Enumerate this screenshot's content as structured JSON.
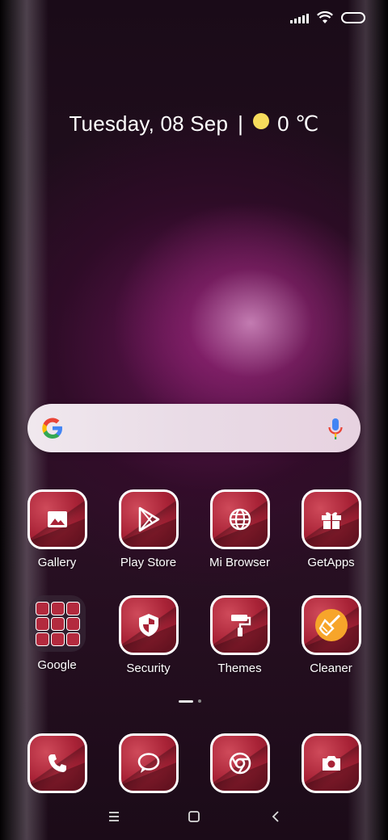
{
  "status_bar": {
    "signal_icon": "signal-icon",
    "wifi_icon": "wifi-icon",
    "battery_icon": "battery-icon"
  },
  "date_widget": {
    "date": "Tuesday, 08 Sep",
    "separator": "|",
    "temperature": "0 ℃",
    "weather_icon": "sun-icon",
    "sun_color": "#f6dc5c"
  },
  "search": {
    "logo_icon": "google-g-icon",
    "mic_icon": "microphone-icon"
  },
  "apps_row1": [
    {
      "label": "Gallery",
      "icon": "image-icon"
    },
    {
      "label": "Play Store",
      "icon": "play-icon"
    },
    {
      "label": "Mi Browser",
      "icon": "globe-icon"
    },
    {
      "label": "GetApps",
      "icon": "gift-icon"
    }
  ],
  "apps_row2": [
    {
      "label": "Google",
      "icon": "folder-icon"
    },
    {
      "label": "Security",
      "icon": "shield-icon"
    },
    {
      "label": "Themes",
      "icon": "paint-roller-icon"
    },
    {
      "label": "Cleaner",
      "icon": "broom-icon"
    }
  ],
  "dock": [
    {
      "icon": "phone-icon"
    },
    {
      "icon": "message-icon"
    },
    {
      "icon": "chrome-icon"
    },
    {
      "icon": "camera-icon"
    }
  ],
  "page_indicator": {
    "pages": 2,
    "current": 1
  },
  "nav_bar": {
    "menu_icon": "menu-icon",
    "home_icon": "home-icon",
    "back_icon": "back-icon"
  },
  "colors": {
    "tile_red": "#a82236",
    "cleaner_orange": "#f7a52a"
  }
}
